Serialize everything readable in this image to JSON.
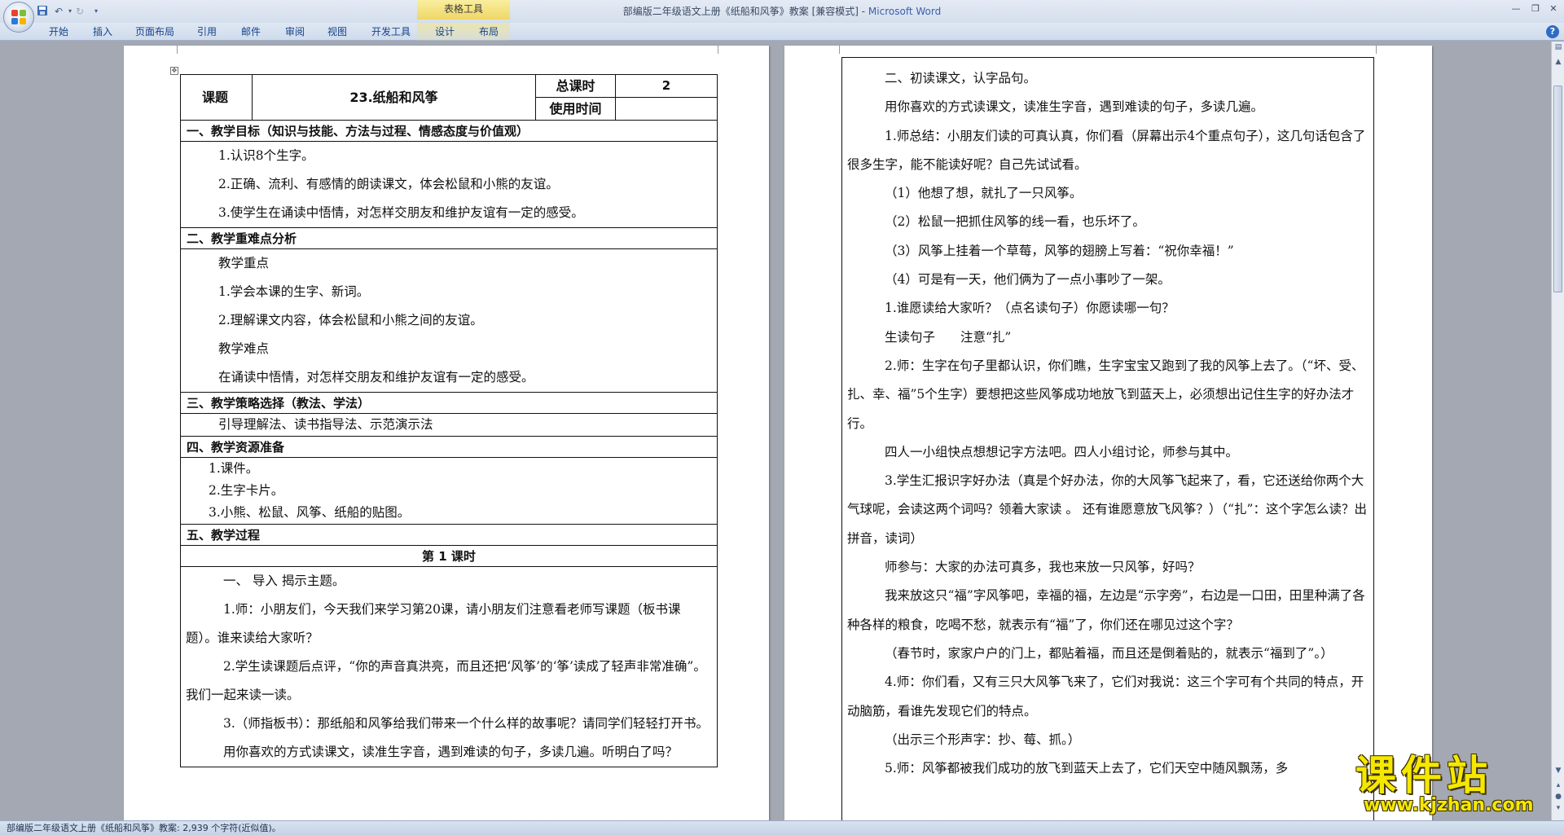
{
  "window": {
    "doc_title": "部编版二年级语文上册《纸船和风筝》教案 [兼容模式] - ",
    "app_name": "Microsoft Word",
    "table_tools_label": "表格工具"
  },
  "ribbon": {
    "tabs": [
      "开始",
      "插入",
      "页面布局",
      "引用",
      "邮件",
      "审阅",
      "视图",
      "开发工具",
      "设计",
      "布局"
    ]
  },
  "page1": {
    "label_cell": "课题",
    "title_cell": "23.纸船和风筝",
    "total_label": "总课时",
    "total_value": "2",
    "time_label": "使用时间",
    "sec1_header": "一、教学目标（知识与技能、方法与过程、情感态度与价值观）",
    "goals": [
      "1.认识8个生字。",
      "2.正确、流利、有感情的朗读课文，体会松鼠和小熊的友谊。",
      "3.使学生在诵读中悟情，对怎样交朋友和维护友谊有一定的感受。"
    ],
    "sec2_header": "二、教学重难点分析",
    "key_points": [
      "教学重点",
      "1.学会本课的生字、新词。",
      "2.理解课文内容，体会松鼠和小熊之间的友谊。",
      "教学难点",
      "在诵读中悟情，对怎样交朋友和维护友谊有一定的感受。"
    ],
    "sec3_header": "三、教学策略选择（教法、学法）",
    "strategy": "引导理解法、读书指导法、示范演示法",
    "sec4_header": "四、教学资源准备",
    "resources": [
      "1.课件。",
      "2.生字卡片。",
      "3.小熊、松鼠、风筝、纸船的贴图。"
    ],
    "sec5_header": "五、教学过程",
    "period_header": "第 1 课时",
    "process": [
      "一、 导入 揭示主题。",
      "1.师：小朋友们，今天我们来学习第20课，请小朋友们注意看老师写课题（板书课题）。谁来读给大家听？",
      "2.学生读课题后点评，“你的声音真洪亮，而且还把‘风筝’的‘筝’读成了轻声非常准确”。我们一起来读一读。",
      "3.（师指板书）：那纸船和风筝给我们带来一个什么样的故事呢？请同学们轻轻打开书。",
      "用你喜欢的方式读课文，读准生字音，遇到难读的句子，多读几遍。听明白了吗？"
    ]
  },
  "page2": {
    "paragraphs": [
      "二、初读课文，认字品句。",
      "用你喜欢的方式读课文，读准生字音，遇到难读的句子，多读几遍。",
      "1.师总结：小朋友们读的可真认真，你们看（屏幕出示4个重点句子），这几句话包含了很多生字，能不能读好呢？自己先试试看。",
      "（1）他想了想，就扎了一只风筝。",
      "（2）松鼠一把抓住风筝的线一看，也乐坏了。",
      "（3）风筝上挂着一个草莓，风筝的翅膀上写着：“祝你幸福！”",
      "（4）可是有一天，他们俩为了一点小事吵了一架。",
      "1.谁愿读给大家听？（点名读句子）你愿读哪一句？",
      "生读句子　　注意“扎”",
      "2.师：生字在句子里都认识，你们瞧，生字宝宝又跑到了我的风筝上去了。（“坏、受、扎、幸、福”5个生字）要想把这些风筝成功地放飞到蓝天上，必须想出记住生字的好办法才行。",
      "四人一小组快点想想记字方法吧。四人小组讨论，师参与其中。",
      "3.学生汇报识字好办法（真是个好办法，你的大风筝飞起来了，看，它还送给你两个大气球呢，会读这两个词吗？领着大家读 。 还有谁愿意放飞风筝？）（“扎”：这个字怎么读？出拼音，读词）",
      "师参与：大家的办法可真多，我也来放一只风筝，好吗？",
      "我来放这只“福”字风筝吧，幸福的福，左边是“示字旁”，右边是一口田，田里种满了各种各样的粮食，吃喝不愁，就表示有“福”了，你们还在哪见过这个字？",
      "（春节时，家家户户的门上，都贴着福，而且还是倒着贴的，就表示“福到了”。）",
      "4.师：你们看，又有三只大风筝飞来了，它们对我说：这三个字可有个共同的特点，开动脑筋，看谁先发现它们的特点。",
      "（出示三个形声字：抄、莓、抓。）",
      "5.师：风筝都被我们成功的放飞到蓝天上去了，它们天空中随风飘荡，多"
    ]
  },
  "status_bar": {
    "text": "部编版二年级语文上册《纸船和风筝》教案: 2,939 个字符(近似值)。"
  },
  "watermark": {
    "title": "课件站",
    "url": "www.kjzhan.com"
  },
  "colors": {
    "workspace": "#a3a8b2",
    "ribbon_tab_text": "#15428b",
    "watermark_yellow": "#f5e800"
  }
}
